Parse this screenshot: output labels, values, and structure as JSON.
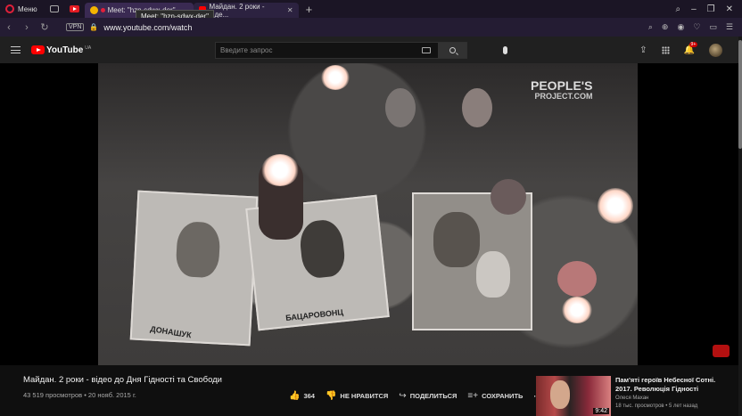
{
  "browser": {
    "menu_label": "Меню",
    "tabs": [
      {
        "title": "Meet: \"hzn-sdwx-der\"",
        "active": false
      },
      {
        "title": "Майдан. 2 роки - віде...",
        "active": true
      }
    ],
    "tooltip": "Meet: \"hzn-sdwx-der\"",
    "vpn_label": "VPN",
    "url": "www.youtube.com/watch"
  },
  "youtube": {
    "logo_text": "YouTube",
    "region": "UA",
    "search_placeholder": "Введите запрос",
    "notif_count": "9+"
  },
  "video": {
    "watermark_line1": "PEOPLE'S",
    "watermark_line2": "PROJECT.COM",
    "photo1_caption": "ДОНАШУК",
    "photo2_caption": "БАЦАРОВОНЦ",
    "title": "Майдан. 2 роки - відео до Дня Гідності та Свободи",
    "views": "43 519 просмотров",
    "date": "20 нояб. 2015 г.",
    "likes": "364",
    "dislike_label": "НЕ НРАВИТСЯ",
    "share_label": "ПОДЕЛИТЬСЯ",
    "save_label": "СОХРАНИТЬ"
  },
  "recommendation": {
    "title": "Пам'яті героїв Небесної Сотні. 2017. Революція Гідності",
    "channel": "Олеся Махан",
    "views": "18 тыс. просмотров",
    "age": "5 лет назад",
    "duration": "9:42"
  },
  "colors": {
    "accent": "#ff0000",
    "tab_bg": "#1b1525"
  }
}
